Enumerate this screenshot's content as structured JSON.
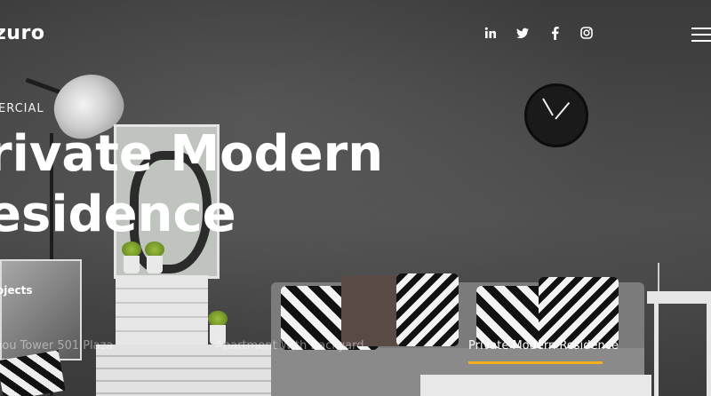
{
  "header": {
    "logo": "zuro",
    "social": [
      {
        "name": "linkedin-icon",
        "glyph": "in"
      },
      {
        "name": "twitter-icon",
        "glyph": "twitter"
      },
      {
        "name": "facebook-icon",
        "glyph": "f"
      },
      {
        "name": "instagram-icon",
        "glyph": "instagram"
      }
    ],
    "menu_icon": "hamburger-menu-icon"
  },
  "hero": {
    "category": "ERCIAL",
    "title_line1": "rivate Modern",
    "title_line2": "esidence"
  },
  "projects": {
    "label": "ojects",
    "items": [
      {
        "label": "hou Tower 501 Plaza."
      },
      {
        "label": "Apartment With Backyard"
      },
      {
        "label": "Private Modern Residence"
      }
    ],
    "active_index": 2,
    "accent_color": "#f2b01e"
  }
}
